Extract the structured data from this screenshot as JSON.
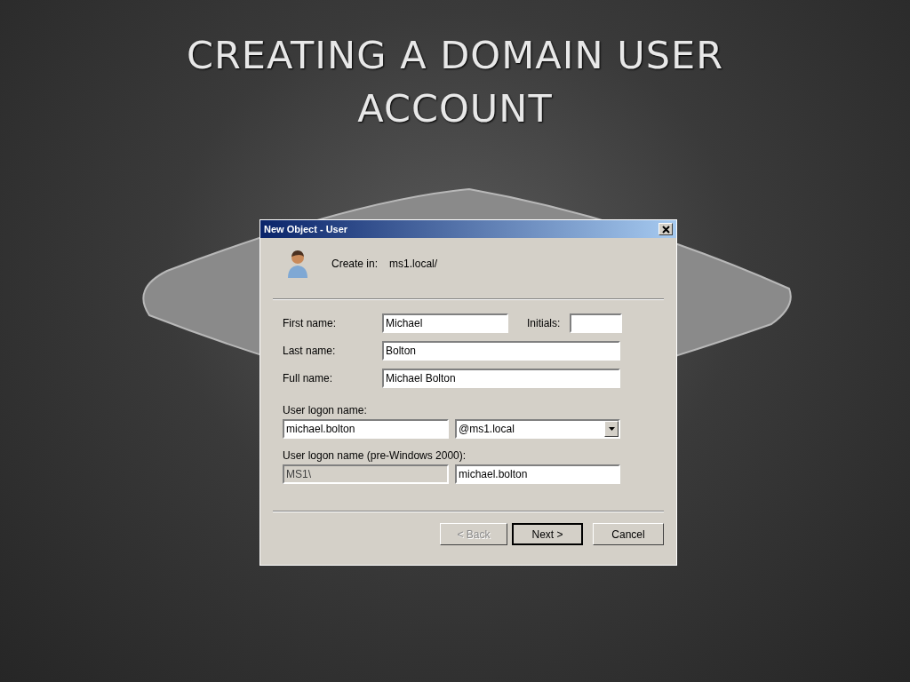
{
  "slide": {
    "title": "CREATING A DOMAIN USER ACCOUNT"
  },
  "dialog": {
    "title": "New Object - User",
    "create_in_label": "Create in:",
    "create_in_value": "ms1.local/",
    "name_fields": [
      {
        "label": "First name:",
        "value": "Michael"
      },
      {
        "label": "Last name:",
        "value": "Bolton"
      },
      {
        "label": "Full name:",
        "value": "Michael Bolton"
      }
    ],
    "initials": {
      "label": "Initials:"
    },
    "logon": {
      "label": "User logon name:",
      "value": "michael.bolton",
      "domain": "@ms1.local"
    },
    "pre2000": {
      "label": "User logon name (pre-Windows 2000):",
      "prefix": "MS1\\",
      "prefix_disabled": true,
      "value": "michael.bolton"
    },
    "buttons": [
      {
        "label": "< Back",
        "disabled": true,
        "default": false
      },
      {
        "label": "Next >",
        "disabled": false,
        "default": true
      },
      {
        "label": "Cancel",
        "disabled": false,
        "default": false
      }
    ]
  }
}
